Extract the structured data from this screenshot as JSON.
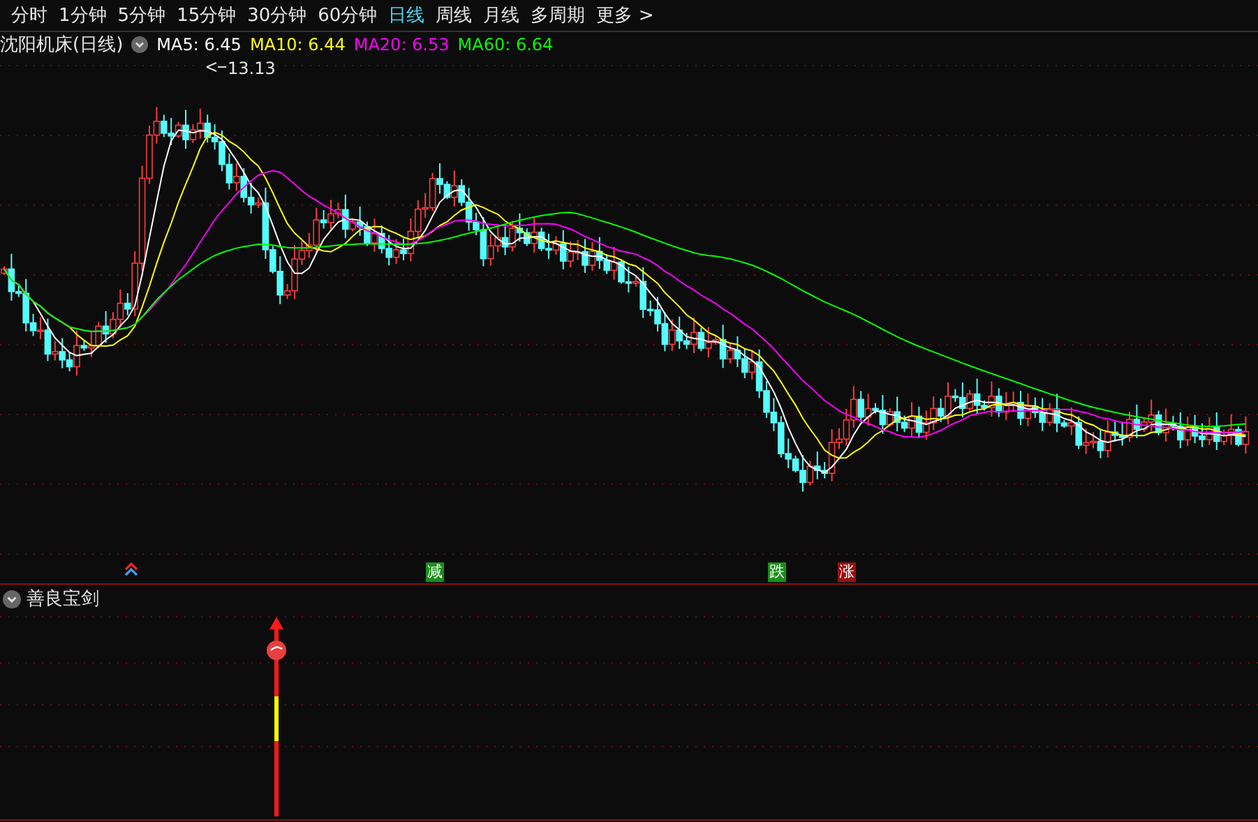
{
  "period_tabs": [
    {
      "label": "分时",
      "selected": false
    },
    {
      "label": "1分钟",
      "selected": false
    },
    {
      "label": "5分钟",
      "selected": false
    },
    {
      "label": "15分钟",
      "selected": false
    },
    {
      "label": "30分钟",
      "selected": false
    },
    {
      "label": "60分钟",
      "selected": false
    },
    {
      "label": "日线",
      "selected": true
    },
    {
      "label": "周线",
      "selected": false
    },
    {
      "label": "月线",
      "selected": false
    },
    {
      "label": "多周期",
      "selected": false
    },
    {
      "label": "更多 >",
      "selected": false
    }
  ],
  "main_chart": {
    "title": "沈阳机床(日线)",
    "moving_averages": [
      {
        "label": "MA5: 6.45",
        "color": "#ffffff"
      },
      {
        "label": "MA10: 6.44",
        "color": "#ffff00"
      },
      {
        "label": "MA20: 6.53",
        "color": "#ff00ff"
      },
      {
        "label": "MA60: 6.64",
        "color": "#00ff00"
      }
    ],
    "high_label": "13.13"
  },
  "signals": [
    {
      "kind": "arrow"
    },
    {
      "kind": "tag",
      "label": "减",
      "color": "#1a8f1a"
    },
    {
      "kind": "tag",
      "label": "跌",
      "color": "#1a8f1a"
    },
    {
      "kind": "tag",
      "label": "涨",
      "color": "#9a0f0f"
    }
  ],
  "indicator_panel": {
    "title": "善良宝剑"
  }
}
